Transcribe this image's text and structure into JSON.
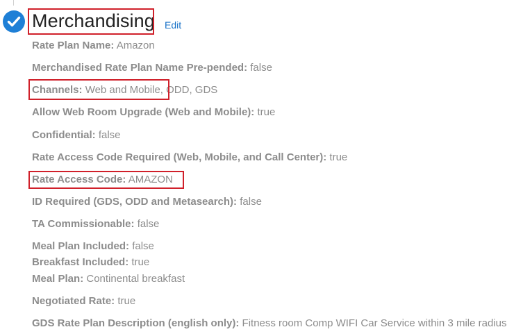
{
  "section": {
    "title": "Merchandising",
    "edit_label": "Edit",
    "status_icon": "check-circle-icon",
    "accent_color": "#1e7fd6",
    "highlight_color": "#d0202a"
  },
  "fields": {
    "rate_plan_name": {
      "label": "Rate Plan Name:",
      "value": "Amazon"
    },
    "merchandised_prepended": {
      "label": "Merchandised Rate Plan Name Pre-pended:",
      "value": "false"
    },
    "channels": {
      "label": "Channels:",
      "value": "Web and Mobile, ODD, GDS"
    },
    "allow_web_room_upgrade": {
      "label": "Allow Web Room Upgrade (Web and Mobile):",
      "value": "true"
    },
    "confidential": {
      "label": "Confidential:",
      "value": "false"
    },
    "rate_access_code_required": {
      "label": "Rate Access Code Required (Web, Mobile, and Call Center):",
      "value": "true"
    },
    "rate_access_code": {
      "label": "Rate Access Code:",
      "value": "AMAZON"
    },
    "id_required": {
      "label": "ID Required (GDS, ODD and Metasearch):",
      "value": "false"
    },
    "ta_commissionable": {
      "label": "TA Commissionable:",
      "value": "false"
    },
    "meal_plan_included": {
      "label": "Meal Plan Included:",
      "value": "false"
    },
    "breakfast_included": {
      "label": "Breakfast Included:",
      "value": "true"
    },
    "meal_plan": {
      "label": "Meal Plan:",
      "value": "Continental breakfast"
    },
    "negotiated_rate": {
      "label": "Negotiated Rate:",
      "value": "true"
    },
    "gds_description": {
      "label": "GDS Rate Plan Description (english only):",
      "value": "Fitness room Comp WIFI Car Service within 3 mile radius"
    }
  }
}
